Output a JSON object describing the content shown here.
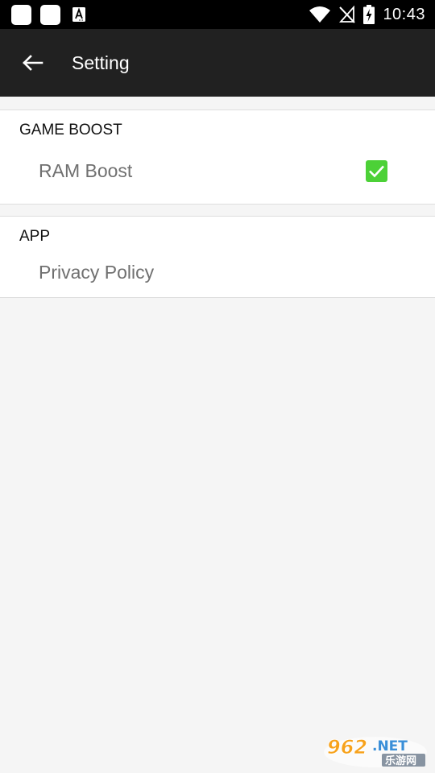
{
  "status_bar": {
    "time": "10:43"
  },
  "app_bar": {
    "title": "Setting",
    "back_icon": "arrow-left-icon"
  },
  "sections": {
    "game_boost": {
      "header": "GAME BOOST",
      "ram_boost_label": "RAM Boost",
      "ram_boost_checked": true
    },
    "app": {
      "header": "APP",
      "privacy_policy_label": "Privacy Policy"
    }
  },
  "watermark": {
    "number": "962",
    "suffix": ".NET",
    "cn": "乐游网"
  },
  "colors": {
    "status_bar": "#000000",
    "app_bar": "#212121",
    "checkbox": "#4cd137",
    "background": "#f5f5f5"
  }
}
